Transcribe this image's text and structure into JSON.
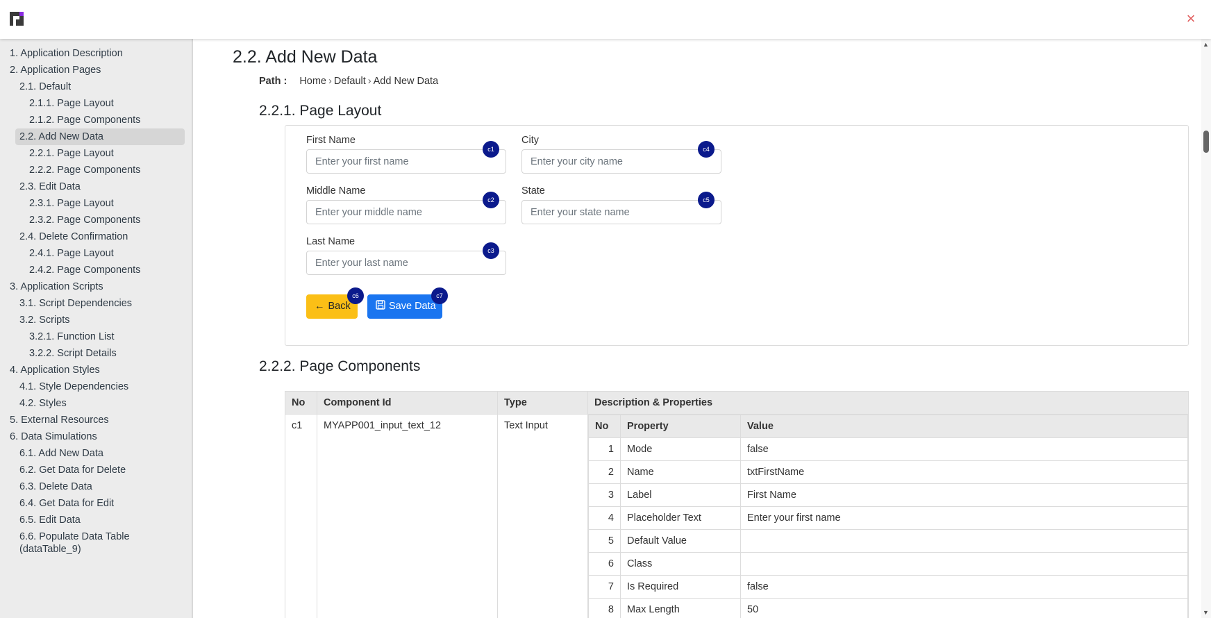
{
  "header": {
    "logo": "app-logo",
    "close_icon": "×"
  },
  "sidebar": {
    "items": [
      {
        "label": "1. Application Description",
        "level": 1
      },
      {
        "label": "2. Application Pages",
        "level": 1
      },
      {
        "label": "2.1. Default",
        "level": 2
      },
      {
        "label": "2.1.1. Page Layout",
        "level": 3
      },
      {
        "label": "2.1.2. Page Components",
        "level": 3
      },
      {
        "label": "2.2. Add New Data",
        "level": 2,
        "active": true
      },
      {
        "label": "2.2.1. Page Layout",
        "level": 3
      },
      {
        "label": "2.2.2. Page Components",
        "level": 3
      },
      {
        "label": "2.3. Edit Data",
        "level": 2
      },
      {
        "label": "2.3.1. Page Layout",
        "level": 3
      },
      {
        "label": "2.3.2. Page Components",
        "level": 3
      },
      {
        "label": "2.4. Delete Confirmation",
        "level": 2
      },
      {
        "label": "2.4.1. Page Layout",
        "level": 3
      },
      {
        "label": "2.4.2. Page Components",
        "level": 3
      },
      {
        "label": "3. Application Scripts",
        "level": 1
      },
      {
        "label": "3.1. Script Dependencies",
        "level": 2
      },
      {
        "label": "3.2. Scripts",
        "level": 2
      },
      {
        "label": "3.2.1. Function List",
        "level": 3
      },
      {
        "label": "3.2.2. Script Details",
        "level": 3
      },
      {
        "label": "4. Application Styles",
        "level": 1
      },
      {
        "label": "4.1. Style Dependencies",
        "level": 2
      },
      {
        "label": "4.2. Styles",
        "level": 2
      },
      {
        "label": "5. External Resources",
        "level": 1
      },
      {
        "label": "6. Data Simulations",
        "level": 1
      },
      {
        "label": "6.1. Add New Data",
        "level": 2
      },
      {
        "label": "6.2. Get Data for Delete",
        "level": 2
      },
      {
        "label": "6.3. Delete Data",
        "level": 2
      },
      {
        "label": "6.4. Get Data for Edit",
        "level": 2
      },
      {
        "label": "6.5. Edit Data",
        "level": 2
      },
      {
        "label": "6.6. Populate Data Table (dataTable_9)",
        "level": 2
      }
    ]
  },
  "main": {
    "title": "2.2. Add New Data",
    "path_label": "Path :",
    "breadcrumb": [
      "Home",
      "Default",
      "Add New Data"
    ],
    "layout_heading": "2.2.1. Page Layout",
    "components_heading": "2.2.2. Page Components"
  },
  "form": {
    "first_name": {
      "label": "First Name",
      "placeholder": "Enter your first name",
      "badge": "c1"
    },
    "middle_name": {
      "label": "Middle Name",
      "placeholder": "Enter your middle name",
      "badge": "c2"
    },
    "last_name": {
      "label": "Last Name",
      "placeholder": "Enter your last name",
      "badge": "c3"
    },
    "city": {
      "label": "City",
      "placeholder": "Enter your city name",
      "badge": "c4"
    },
    "state": {
      "label": "State",
      "placeholder": "Enter your state name",
      "badge": "c5"
    },
    "back": {
      "label": "Back",
      "icon": "←",
      "badge": "c6"
    },
    "save": {
      "label": "Save Data",
      "icon": "save-icon",
      "badge": "c7"
    }
  },
  "components_table": {
    "headers": [
      "No",
      "Component Id",
      "Type",
      "Description & Properties"
    ],
    "rows": [
      {
        "no": "c1",
        "component_id": "MYAPP001_input_text_12",
        "type": "Text Input",
        "prop_headers": [
          "No",
          "Property",
          "Value"
        ],
        "properties": [
          {
            "no": "1",
            "property": "Mode",
            "value": "false"
          },
          {
            "no": "2",
            "property": "Name",
            "value": "txtFirstName"
          },
          {
            "no": "3",
            "property": "Label",
            "value": "First Name"
          },
          {
            "no": "4",
            "property": "Placeholder Text",
            "value": "Enter your first name"
          },
          {
            "no": "5",
            "property": "Default Value",
            "value": ""
          },
          {
            "no": "6",
            "property": "Class",
            "value": ""
          },
          {
            "no": "7",
            "property": "Is Required",
            "value": "false"
          },
          {
            "no": "8",
            "property": "Max Length",
            "value": "50"
          }
        ]
      }
    ]
  }
}
